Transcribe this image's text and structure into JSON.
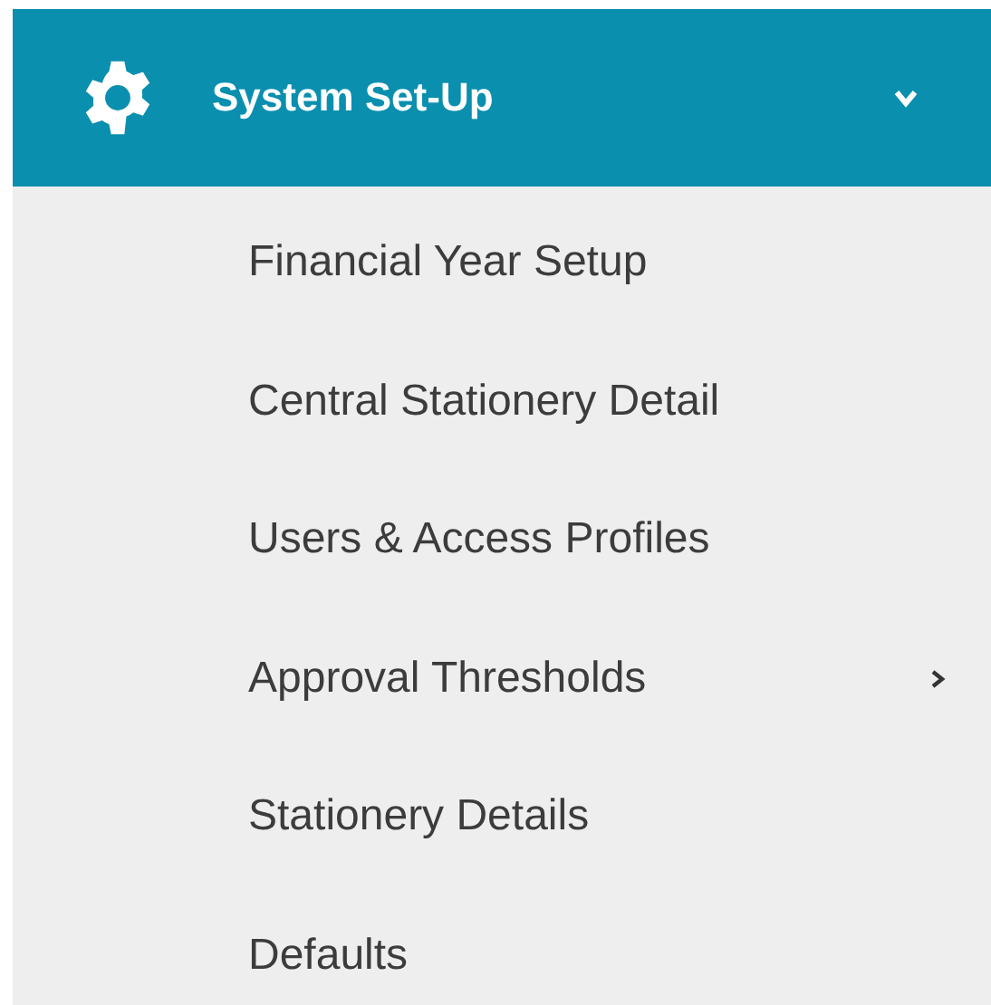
{
  "menu": {
    "title": "System Set-Up",
    "expanded": true,
    "items": [
      {
        "label": "Financial Year Setup",
        "has_submenu": false
      },
      {
        "label": "Central Stationery Detail",
        "has_submenu": false
      },
      {
        "label": "Users & Access Profiles",
        "has_submenu": false
      },
      {
        "label": "Approval Thresholds",
        "has_submenu": true
      },
      {
        "label": "Stationery Details",
        "has_submenu": false
      },
      {
        "label": "Defaults",
        "has_submenu": false
      }
    ]
  }
}
